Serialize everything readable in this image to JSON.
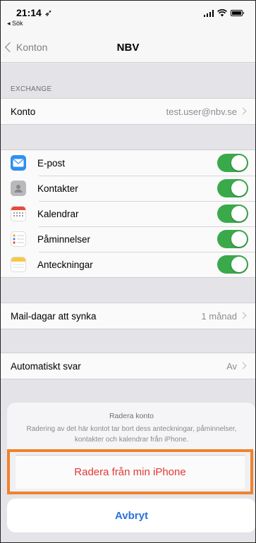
{
  "status_bar": {
    "time": "21:14 ➶",
    "back_app": "◂ Sök"
  },
  "nav": {
    "back_label": "Konton",
    "title": "NBV"
  },
  "exchange": {
    "section_header": "EXCHANGE",
    "account_label": "Konto",
    "account_value": "test.user@nbv.se"
  },
  "services": [
    {
      "label": "E-post",
      "icon": "mail-icon",
      "enabled": true
    },
    {
      "label": "Kontakter",
      "icon": "contacts-icon",
      "enabled": true
    },
    {
      "label": "Kalendrar",
      "icon": "calendar-icon",
      "enabled": true
    },
    {
      "label": "Påminnelser",
      "icon": "reminders-icon",
      "enabled": true
    },
    {
      "label": "Anteckningar",
      "icon": "notes-icon",
      "enabled": true
    }
  ],
  "sync": {
    "label": "Mail-dagar att synka",
    "value": "1 månad"
  },
  "auto_reply": {
    "label": "Automatiskt svar",
    "value": "Av"
  },
  "action_sheet": {
    "title": "Radera konto",
    "message": "Radering av det här kontot tar bort dess anteckningar, påminnelser, kontakter och kalendrar från iPhone.",
    "delete_label": "Radera från min iPhone",
    "cancel_label": "Avbryt"
  },
  "colors": {
    "toggle_on": "#3aa94a",
    "destructive": "#e03a36",
    "link": "#2a72d8",
    "highlight": "#f0822d"
  }
}
